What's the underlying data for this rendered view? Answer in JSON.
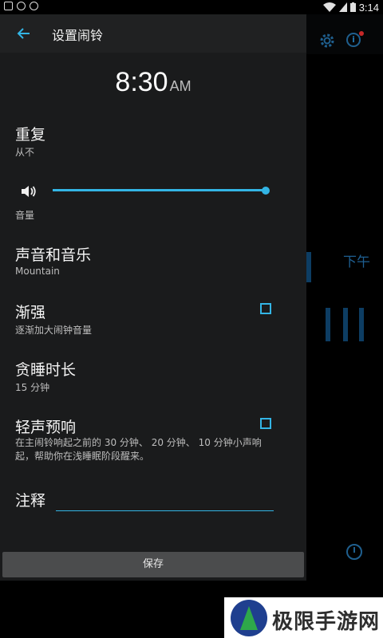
{
  "status_bar": {
    "time": "3:14"
  },
  "dialog": {
    "title": "设置闹铃",
    "alarm_time": "8:30",
    "alarm_ampm": "AM",
    "repeat": {
      "title": "重复",
      "value": "从不"
    },
    "volume": {
      "label": "音量",
      "level": 1.0
    },
    "sound": {
      "title": "声音和音乐",
      "value": "Mountain"
    },
    "crescendo": {
      "title": "渐强",
      "description": "逐渐加大闹钟音量",
      "checked": false
    },
    "snooze": {
      "title": "贪睡时长",
      "value": "15 分钟"
    },
    "pre_alarm": {
      "title": "轻声预响",
      "description": "在主闹铃响起之前的 30 分钟、 20 分钟、 10 分钟小声响起，帮助你在浅睡眠阶段醒来。",
      "checked": false
    },
    "note": {
      "label": "注释",
      "value": ""
    },
    "save_label": "保存"
  },
  "background": {
    "ampm": "下午"
  },
  "watermark": {
    "text": "极限手游网"
  },
  "colors": {
    "accent": "#33b5e5",
    "dialog_bg": "#1a1b1c",
    "header_bg": "#202122",
    "button_bg": "#4b4c4d"
  }
}
